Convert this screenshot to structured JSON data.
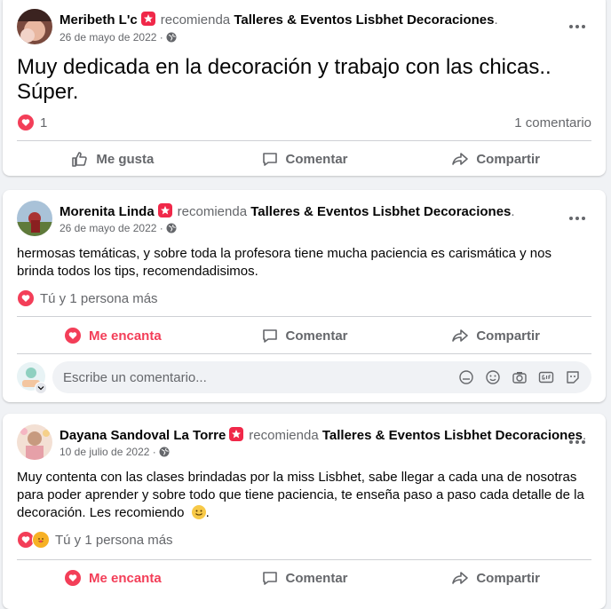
{
  "posts": [
    {
      "author": "Meribeth L'c",
      "recommends": "recomienda",
      "page": "Talleres & Eventos Lisbhet Decoraciones",
      "period": ".",
      "date": "26 de mayo de 2022",
      "date_sep": "·",
      "text": "Muy dedicada en la decoración y trabajo con las chicas.. Súper.",
      "reactions": "1",
      "comments": "1 comentario",
      "actions": [
        "Me gusta",
        "Comentar",
        "Compartir"
      ]
    },
    {
      "author": "Morenita Linda",
      "recommends": "recomienda",
      "page": "Talleres & Eventos Lisbhet Decoraciones",
      "period": ".",
      "date": "26 de mayo de 2022",
      "date_sep": "·",
      "text": "hermosas temáticas, y sobre toda la profesora tiene mucha paciencia es carismática y nos brinda todos los tips, recomendadisimos.",
      "reactions": "Tú y 1 persona más",
      "actions": [
        "Me encanta",
        "Comentar",
        "Compartir"
      ],
      "comment_placeholder": "Escribe un comentario..."
    },
    {
      "author": "Dayana Sandoval La Torre",
      "recommends": "recomienda",
      "page": "Talleres & Eventos Lisbhet Decoraciones",
      "period": ".",
      "date": "10 de julio de 2022",
      "date_sep": "·",
      "text": "Muy contenta con las clases brindadas por la miss Lisbhet, sabe llegar a cada una de nosotras para poder aprender y sobre todo que tiene paciencia, te enseña paso a paso cada detalle de la decoración. Les recomiendo",
      "text_end": ".",
      "reactions": "Tú y 1 persona más",
      "actions": [
        "Me encanta",
        "Comentar",
        "Compartir"
      ]
    }
  ],
  "colors": {
    "background": "#f0f2f5",
    "love": "#f33e58",
    "secondary_text": "#65676b",
    "recommend_badge": "#f02849"
  }
}
